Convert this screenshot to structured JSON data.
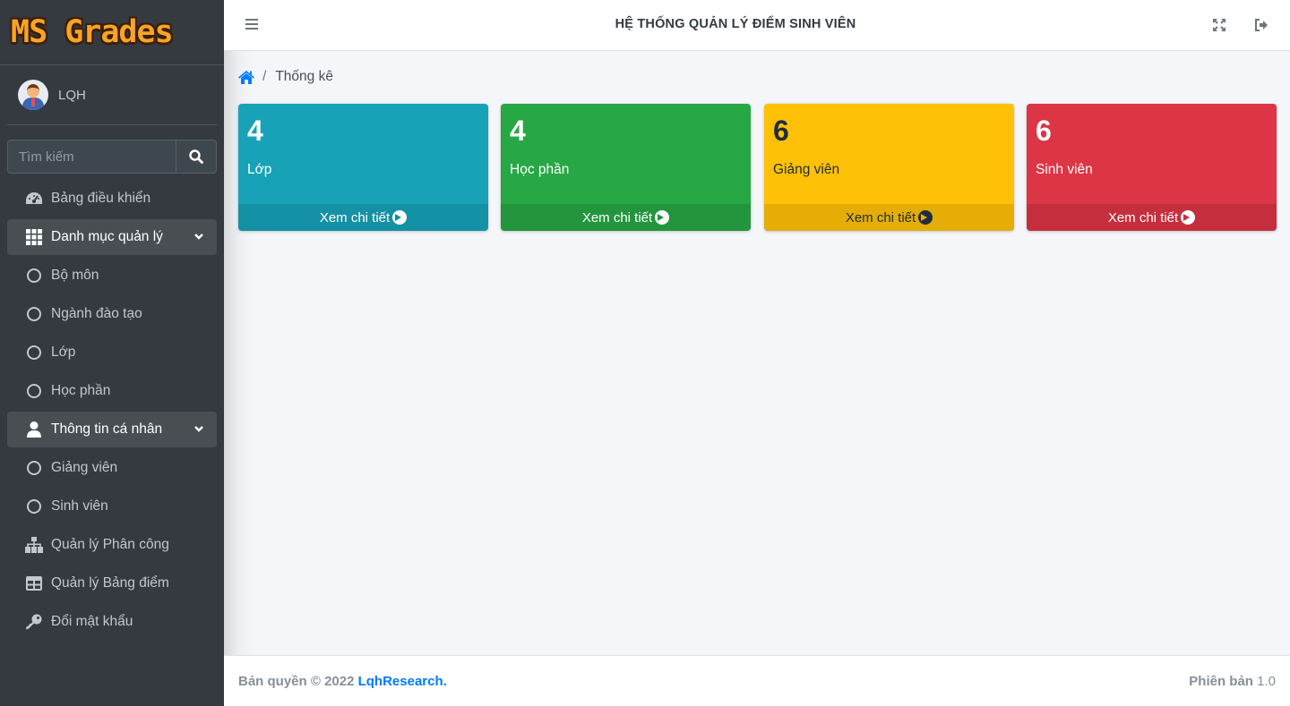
{
  "brand": {
    "logo_text": "MS Grades"
  },
  "user": {
    "name": "LQH"
  },
  "search": {
    "placeholder": "Tìm kiếm"
  },
  "sidebar": {
    "items": [
      {
        "label": "Bảng điều khiển",
        "icon": "tachometer-icon"
      },
      {
        "label": "Danh mục quản lý",
        "icon": "grid-icon",
        "expanded": true
      },
      {
        "label": "Bộ môn",
        "icon": "circle-icon"
      },
      {
        "label": "Ngành đào tạo",
        "icon": "circle-icon"
      },
      {
        "label": "Lớp",
        "icon": "circle-icon"
      },
      {
        "label": "Học phần",
        "icon": "circle-icon"
      },
      {
        "label": "Thông tin cá nhân",
        "icon": "user-icon",
        "expanded": true
      },
      {
        "label": "Giảng viên",
        "icon": "circle-icon"
      },
      {
        "label": "Sinh viên",
        "icon": "circle-icon"
      },
      {
        "label": "Quản lý Phân công",
        "icon": "sitemap-icon"
      },
      {
        "label": "Quản lý Bảng điểm",
        "icon": "table-icon"
      },
      {
        "label": "Đổi mật khẩu",
        "icon": "key-icon"
      }
    ]
  },
  "header": {
    "title": "HỆ THỐNG QUẢN LÝ ĐIỂM SINH VIÊN"
  },
  "breadcrumb": {
    "current": "Thống kê"
  },
  "cards": [
    {
      "count": "4",
      "label": "Lớp",
      "link": "Xem chi tiết",
      "color": "#17a2b8"
    },
    {
      "count": "4",
      "label": "Học phần",
      "link": "Xem chi tiết",
      "color": "#28a745"
    },
    {
      "count": "6",
      "label": "Giảng viên",
      "link": "Xem chi tiết",
      "color": "#ffc107"
    },
    {
      "count": "6",
      "label": "Sinh viên",
      "link": "Xem chi tiết",
      "color": "#dc3545"
    }
  ],
  "footer": {
    "copyright": "Bản quyền © 2022",
    "company": "LqhResearch.",
    "version_label": "Phiên bản",
    "version": "1.0"
  },
  "colors": {
    "sidebar_bg": "#343a40",
    "link_blue": "#007bff",
    "content_bg": "#f4f6f9"
  }
}
